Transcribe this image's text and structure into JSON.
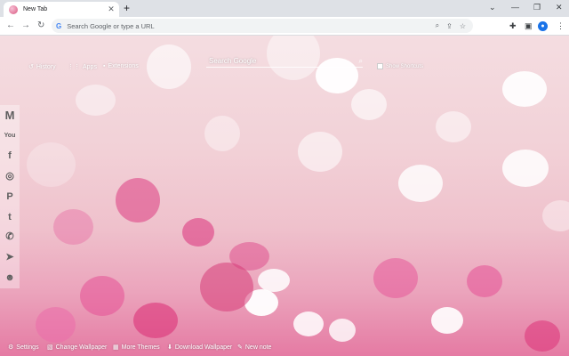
{
  "browser": {
    "tab_title": "New Tab",
    "tab_close": "✕",
    "new_tab": "+",
    "win_controls": {
      "dropdown": "⌄",
      "minimize": "—",
      "restore": "❐",
      "close": "✕"
    },
    "nav": {
      "back": "←",
      "forward": "→",
      "reload": "↻"
    },
    "omnibox_placeholder": "Search Google or type a URL",
    "omnibox_g": "G",
    "omnibox_icons": {
      "zoom": "⌕",
      "share": "⇪",
      "star": "☆"
    },
    "toolbar_icons": {
      "extensions": "✚",
      "sidepanel": "▣",
      "menu": "⋮"
    }
  },
  "newtab": {
    "top_links": [
      {
        "label": "History",
        "icon": "history-icon",
        "glyph": "↺"
      },
      {
        "label": "Apps",
        "icon": "apps-grid-icon",
        "glyph": "⋮⋮"
      },
      {
        "label": "Extensions",
        "icon": "puzzle-icon",
        "glyph": "▪"
      }
    ],
    "search_placeholder": "Search Google",
    "search_glyph": "⌕",
    "show_shortcuts_label": "Show Shortcuts",
    "sidebar": [
      {
        "name": "gmail-icon",
        "glyph": "M"
      },
      {
        "name": "youtube-icon",
        "glyph": "You"
      },
      {
        "name": "facebook-icon",
        "glyph": "f"
      },
      {
        "name": "instagram-icon",
        "glyph": "◎"
      },
      {
        "name": "pinterest-icon",
        "glyph": "P"
      },
      {
        "name": "twitter-icon",
        "glyph": "t"
      },
      {
        "name": "whatsapp-icon",
        "glyph": "✆"
      },
      {
        "name": "telegram-icon",
        "glyph": "➤"
      },
      {
        "name": "reddit-icon",
        "glyph": "☻"
      }
    ],
    "bottom_links": [
      {
        "label": "Settings",
        "icon": "gear-icon",
        "glyph": "⚙"
      },
      {
        "label": "Change Wallpaper",
        "icon": "image-icon",
        "glyph": "▧"
      },
      {
        "label": "More Themes",
        "icon": "themes-icon",
        "glyph": "▦"
      },
      {
        "label": "Download Wallpaper",
        "icon": "download-icon",
        "glyph": "⬇"
      },
      {
        "label": "New note",
        "icon": "note-icon",
        "glyph": "✎"
      }
    ]
  },
  "colors": {
    "accent": "#e57aa3",
    "bokeh": "#ffffff",
    "pink_bokeh": "#e0407f"
  }
}
